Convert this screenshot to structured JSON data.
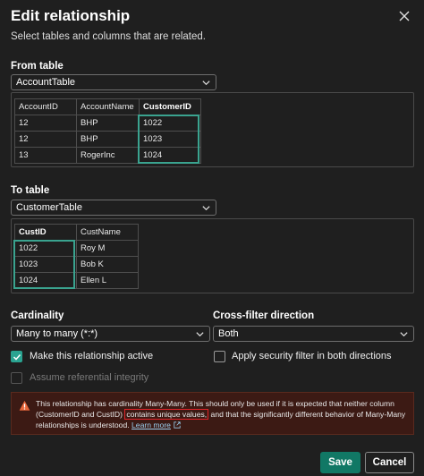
{
  "dialog": {
    "title": "Edit relationship",
    "subtitle": "Select tables and columns that are related."
  },
  "from_table": {
    "label": "From table",
    "selected": "AccountTable",
    "columns": [
      "AccountID",
      "AccountName",
      "CustomerID"
    ],
    "selected_column": "CustomerID",
    "rows": [
      [
        "12",
        "BHP",
        "1022"
      ],
      [
        "12",
        "BHP",
        "1023"
      ],
      [
        "13",
        "RogerInc",
        "1024"
      ]
    ]
  },
  "to_table": {
    "label": "To table",
    "selected": "CustomerTable",
    "columns": [
      "CustID",
      "CustName"
    ],
    "selected_column": "CustID",
    "rows": [
      [
        "1022",
        "Roy M"
      ],
      [
        "1023",
        "Bob K"
      ],
      [
        "1024",
        "Ellen L"
      ]
    ]
  },
  "cardinality": {
    "label": "Cardinality",
    "selected": "Many to many (*:*)"
  },
  "cross_filter": {
    "label": "Cross-filter direction",
    "selected": "Both"
  },
  "options": {
    "active_label": "Make this relationship active",
    "active_checked": true,
    "security_label": "Apply security filter in both directions",
    "security_checked": false,
    "referential_label": "Assume referential integrity",
    "referential_enabled": false
  },
  "warning": {
    "text_before": "This relationship has cardinality Many-Many. This should only be used if it is expected that neither column (CustomerID and CustID) ",
    "highlighted": "contains unique values,",
    "text_after": " and that the significantly different behavior of Many-Many relationships is understood. ",
    "link": "Learn more"
  },
  "buttons": {
    "save": "Save",
    "cancel": "Cancel"
  },
  "colors": {
    "accent": "#117865",
    "selection": "#3aa38f",
    "warning_bg": "#3c1a14",
    "highlight": "#e0242a"
  }
}
